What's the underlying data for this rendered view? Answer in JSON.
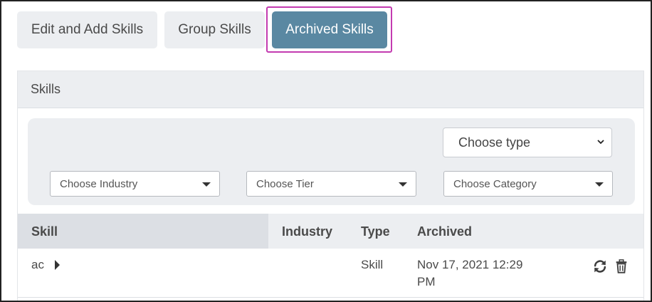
{
  "tabs": {
    "edit_add": "Edit and Add Skills",
    "group": "Group Skills",
    "archived": "Archived Skills"
  },
  "panel": {
    "title": "Skills"
  },
  "filters": {
    "type": "Choose type",
    "industry": "Choose Industry",
    "tier": "Choose Tier",
    "category": "Choose Category"
  },
  "table": {
    "headers": {
      "skill": "Skill",
      "industry": "Industry",
      "type": "Type",
      "archived": "Archived"
    },
    "rows": [
      {
        "skill": "ac",
        "industry": "",
        "type": "Skill",
        "archived_line1": "Nov 17, 2021 12:29",
        "archived_line2": "PM"
      }
    ]
  },
  "icons": {
    "restore": "refresh-icon",
    "delete": "trash-icon"
  },
  "colors": {
    "active_tab": "#5a88a2",
    "highlight": "#c33bb0",
    "tab_bg": "#eceef1"
  }
}
